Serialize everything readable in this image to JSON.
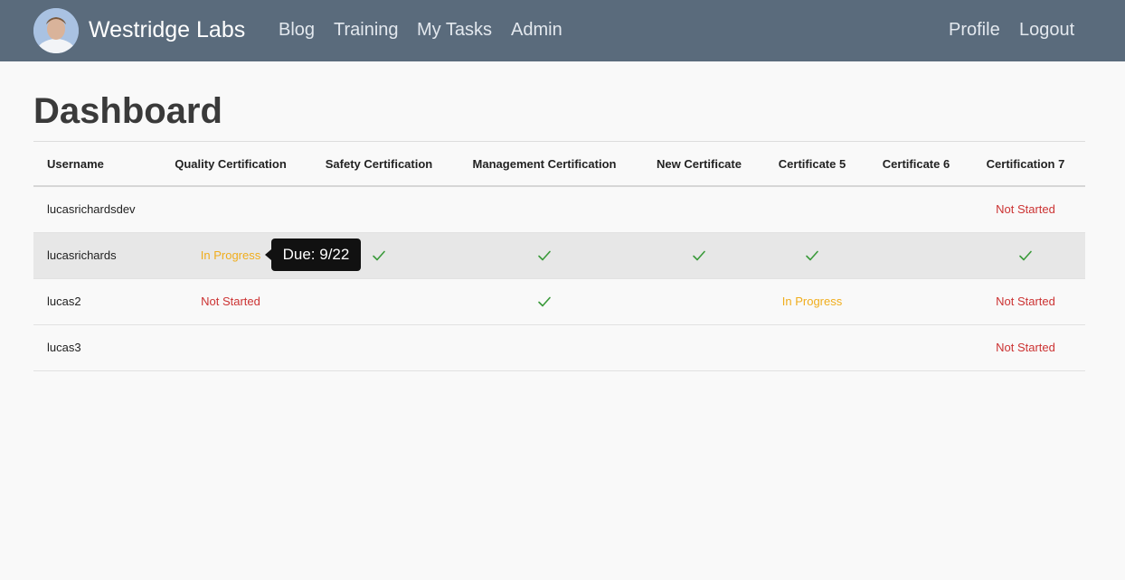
{
  "nav": {
    "brand": "Westridge Labs",
    "links": [
      "Blog",
      "Training",
      "My Tasks",
      "Admin"
    ],
    "right_links": [
      "Profile",
      "Logout"
    ]
  },
  "page": {
    "title": "Dashboard"
  },
  "table": {
    "headers": [
      "Username",
      "Quality Certification",
      "Safety Certification",
      "Management Certification",
      "New Certificate",
      "Certificate 5",
      "Certificate 6",
      "Certification 7"
    ],
    "rows": [
      {
        "username": "lucasrichardsdev",
        "cells": [
          "",
          "",
          "",
          "",
          "",
          "",
          "Not Started"
        ]
      },
      {
        "username": "lucasrichards",
        "cells": [
          "In Progress",
          "check",
          "check",
          "check",
          "check",
          "",
          "check"
        ]
      },
      {
        "username": "lucas2",
        "cells": [
          "Not Started",
          "",
          "check",
          "",
          "In Progress",
          "",
          "Not Started"
        ]
      },
      {
        "username": "lucas3",
        "cells": [
          "",
          "",
          "",
          "",
          "",
          "",
          "Not Started"
        ]
      }
    ]
  },
  "tooltip": {
    "text": "Due: 9/22"
  },
  "colors": {
    "navbar": "#5a6b7c",
    "in_progress": "#f0ad1c",
    "not_started": "#cc3333",
    "check": "#3a9a3a"
  }
}
